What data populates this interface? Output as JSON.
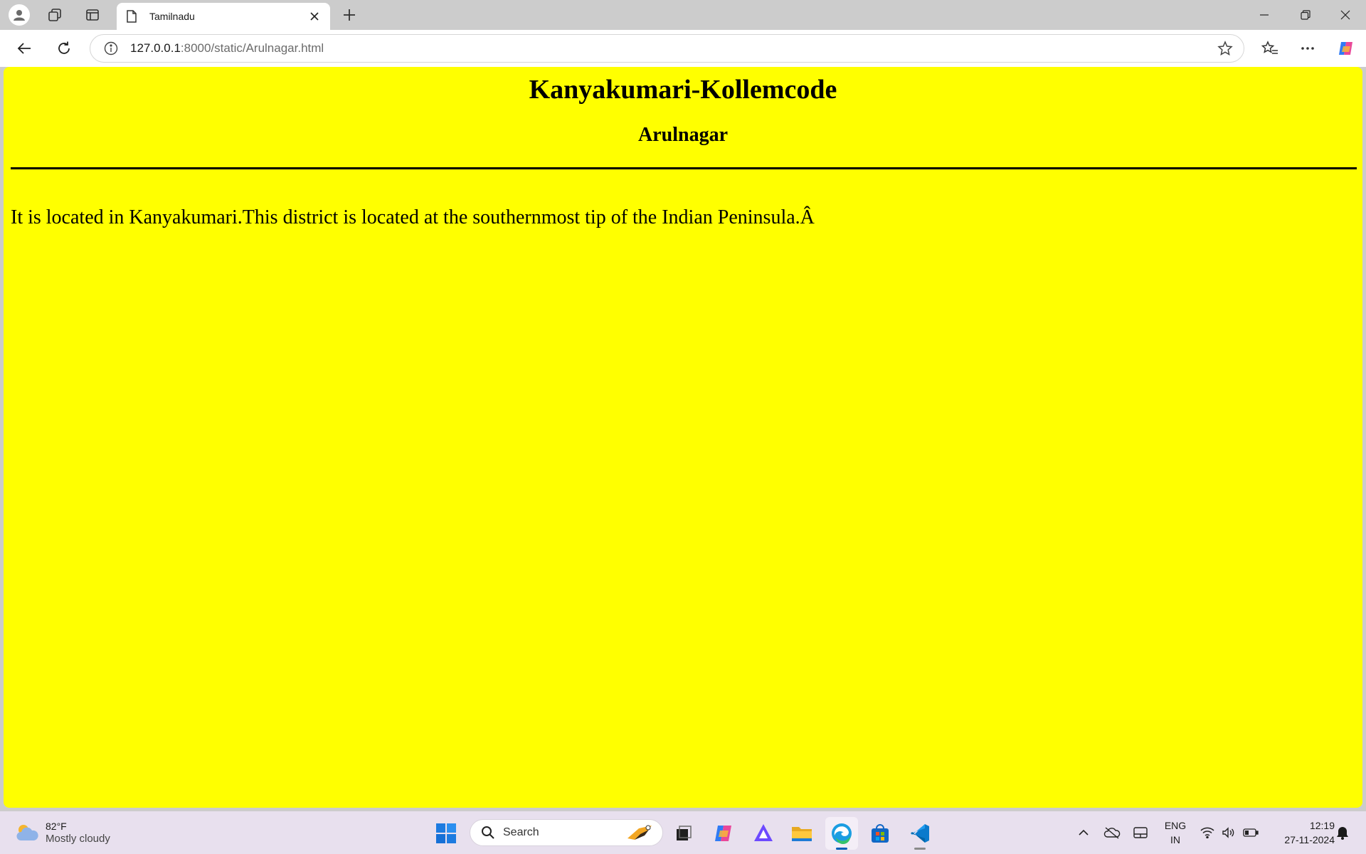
{
  "browser": {
    "tab": {
      "title": "Tamilnadu"
    },
    "address": {
      "host": "127.0.0.1",
      "path": ":8000/static/Arulnagar.html"
    }
  },
  "page": {
    "background": "#ffff00",
    "heading": "Kanyakumari-Kollemcode",
    "subheading": "Arulnagar",
    "paragraph": "It is located in Kanyakumari.This district is located at the southernmost tip of the Indian Peninsula.Â"
  },
  "taskbar": {
    "weather": {
      "temp": "82°F",
      "condition": "Mostly cloudy"
    },
    "search_placeholder": "Search",
    "apps": [
      "start-icon",
      "search-icon",
      "task-view-icon",
      "copilot-icon",
      "proton-vpn-icon",
      "file-explorer-icon",
      "edge-icon",
      "microsoft-store-icon",
      "vscode-icon"
    ],
    "tray": {
      "lang_line1": "ENG",
      "lang_line2": "IN",
      "time": "12:19",
      "date": "27-11-2024"
    }
  },
  "colors": {
    "tabstrip": "#cccccc",
    "taskbar": "#e8e0ee",
    "accent": "#005fb8"
  }
}
